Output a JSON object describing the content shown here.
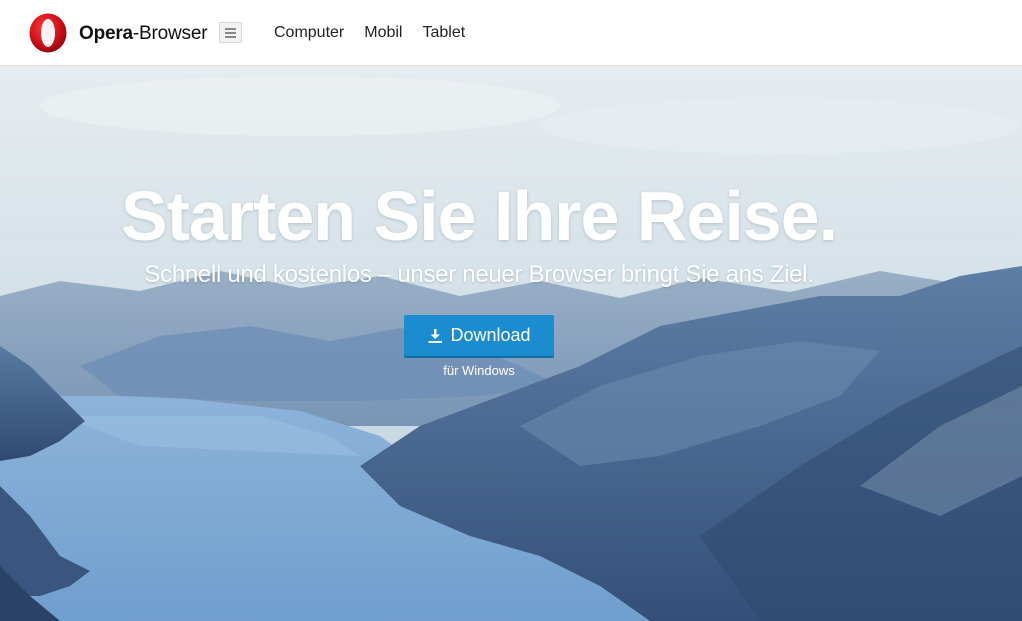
{
  "header": {
    "brand_bold": "Opera",
    "brand_regular": "-Browser",
    "nav": [
      "Computer",
      "Mobil",
      "Tablet"
    ]
  },
  "hero": {
    "headline": "Starten Sie Ihre Reise.",
    "subline": "Schnell und kostenlos – unser neuer Browser bringt Sie ans Ziel.",
    "download_label": "Download",
    "platform_note": "für Windows"
  },
  "colors": {
    "opera_red": "#cc0f16",
    "download_blue": "#1a8ccf",
    "sky": "#dfe8ee",
    "water": "#7fa8d2",
    "mountains": "#4a6a94"
  },
  "icons": {
    "logo": "opera-logo-icon",
    "menu": "hamburger-menu-icon",
    "download": "download-arrow-icon"
  }
}
